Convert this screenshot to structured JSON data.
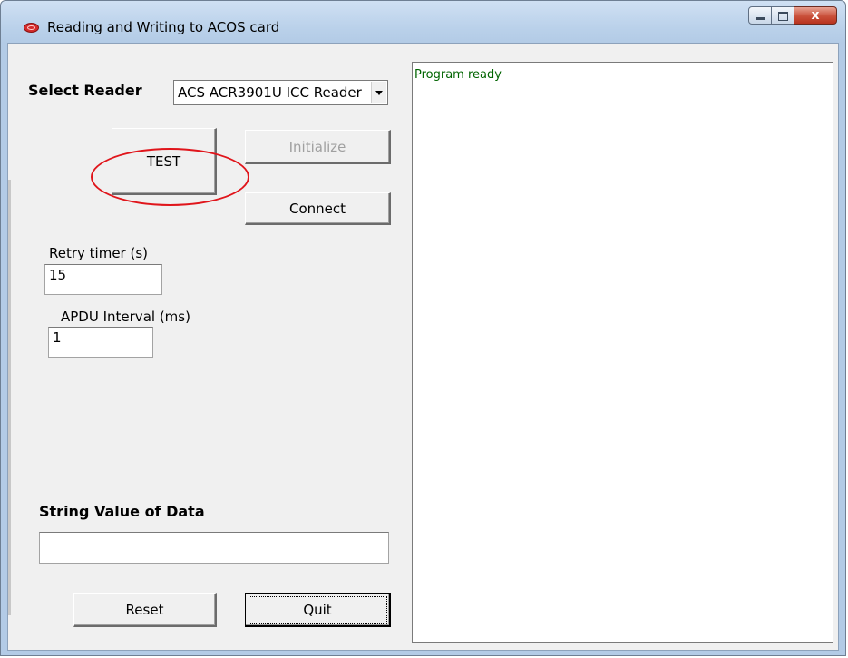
{
  "window": {
    "title": "Reading and Writing to ACOS card",
    "close_glyph": "x",
    "icon": "acs-app-icon"
  },
  "reader": {
    "label": "Select Reader",
    "selected": "ACS ACR3901U ICC Reader"
  },
  "buttons": {
    "test": "TEST",
    "initialize": "Initialize",
    "connect": "Connect",
    "reset": "Reset",
    "quit": "Quit"
  },
  "retry": {
    "label": "Retry timer (s)",
    "value": "15"
  },
  "apdu": {
    "label": "APDU Interval (ms)",
    "value": "1"
  },
  "string_data": {
    "label": "String Value of Data",
    "value": ""
  },
  "log": {
    "lines": [
      "Program ready"
    ]
  },
  "colors": {
    "log_text": "#006400",
    "annotation": "#e0151b"
  }
}
